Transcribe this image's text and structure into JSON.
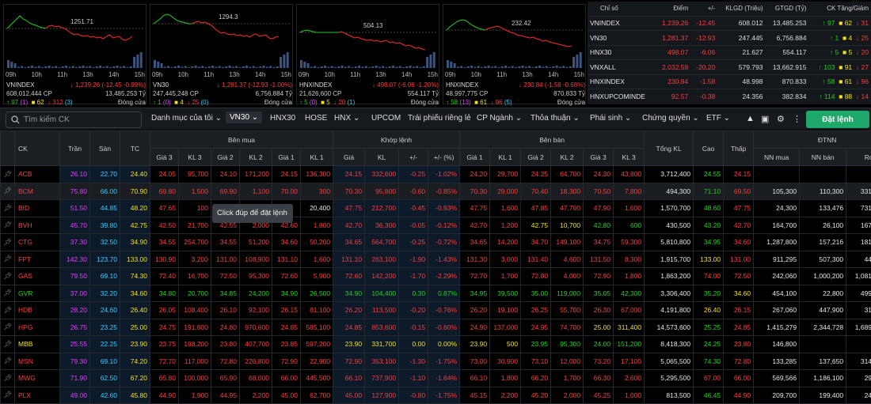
{
  "charts": [
    {
      "name": "VNINDEX",
      "ref_label": "1251.71",
      "value": "1,239.26",
      "change": "(-12.45 -0.99%)",
      "volume": "608,012,444 CP",
      "value_total": "13,485.253 Tỷ",
      "up": "97",
      "up_ceiling": "(1)",
      "ref": "62",
      "down": "312",
      "down_floor": "(3)",
      "status": "Đóng cửa"
    },
    {
      "name": "VN30",
      "ref_label": "1294.3",
      "value": "1,281.37",
      "change": "(-12.93 -1.00%)",
      "volume": "247,445,248 CP",
      "value_total": "6,756.884 Tỷ",
      "up": "1",
      "up_ceiling": "(0)",
      "ref": "4",
      "down": "25",
      "down_floor": "(0)",
      "status": "Đóng cửa"
    },
    {
      "name": "HNXINDEX",
      "ref_label": "504.13",
      "value": "498.07",
      "change": "(-6.06 -1.20%)",
      "volume": "21,626,600 CP",
      "value_total": "554.117 Tỷ",
      "up": "5",
      "up_ceiling": "(0)",
      "ref": "5",
      "down": "20",
      "down_floor": "(1)",
      "status": "Đóng cửa"
    },
    {
      "name": "HNXINDEX",
      "ref_label": "232.42",
      "value": "230.84",
      "change": "(-1.58 -0.68%)",
      "volume": "48,997,775 CP",
      "value_total": "870.833 Tỷ",
      "up": "58",
      "up_ceiling": "(13)",
      "ref": "61",
      "down": "96",
      "down_floor": "(5)",
      "status": "Đóng cửa"
    }
  ],
  "chart_times": [
    "09h",
    "10h",
    "11h",
    "13h",
    "14h",
    "15h"
  ],
  "index_table": {
    "headers": [
      "Chỉ số",
      "Điểm",
      "+/-",
      "KLGD (Triệu)",
      "GTGD (Tỷ)",
      "CK Tăng/Giảm"
    ],
    "rows": [
      {
        "name": "VNINDEX",
        "point": "1,239.26",
        "chg": "-12.45",
        "vol": "608.012",
        "val": "13,485.253",
        "up": "97",
        "ref": "62",
        "down": "31"
      },
      {
        "name": "VN30",
        "point": "1,281.37",
        "chg": "-12.93",
        "vol": "247.445",
        "val": "6,756.884",
        "up": "1",
        "ref": "4",
        "down": "25"
      },
      {
        "name": "HNX30",
        "point": "498.07",
        "chg": "-6.06",
        "vol": "21.627",
        "val": "554.117",
        "up": "5",
        "ref": "5",
        "down": "20"
      },
      {
        "name": "VNXALL",
        "point": "2,032.58",
        "chg": "-20.20",
        "vol": "579.793",
        "val": "13,662.915",
        "up": "103",
        "ref": "91",
        "down": "27"
      },
      {
        "name": "HNXINDEX",
        "point": "230.84",
        "chg": "-1.58",
        "vol": "48.998",
        "val": "870.833",
        "up": "58",
        "ref": "61",
        "down": "96"
      },
      {
        "name": "HNXUPCOMINDE",
        "point": "92.57",
        "chg": "-0.38",
        "vol": "24.356",
        "val": "382.834",
        "up": "114",
        "ref": "88",
        "down": "14"
      }
    ]
  },
  "toolbar": {
    "search_placeholder": "Tìm kiếm CK",
    "tabs": [
      "Danh mục của tôi",
      "VN30",
      "HNX30",
      "HOSE",
      "HNX",
      "UPCOM",
      "Trái phiếu riêng lẻ",
      "CP Ngành",
      "Thỏa thuận",
      "Phái sinh",
      "Chứng quyền",
      "ETF"
    ],
    "order_button": "Đặt lệnh"
  },
  "board": {
    "group_headers": {
      "buy": "Bên mua",
      "match": "Khớp lệnh",
      "sell": "Bên bán",
      "foreign": "ĐTNN"
    },
    "headers": [
      "CK",
      "Trần",
      "Sàn",
      "TC",
      "Giá 3",
      "KL 3",
      "Giá 2",
      "KL 2",
      "Giá 1",
      "KL 1",
      "Giá",
      "KL",
      "+/-",
      "+/- (%)",
      "Giá 1",
      "KL 1",
      "Giá 2",
      "KL 2",
      "Giá 3",
      "KL 3",
      "Tổng KL",
      "Cao",
      "Thấp",
      "NN mua",
      "NN bán",
      "Room"
    ],
    "rows": [
      [
        "ACB",
        "26.10",
        "22.70",
        "24.40",
        "24.05",
        "95,700",
        "24.10",
        "171,200",
        "24.15",
        "136,300",
        "24.15",
        "332,600",
        "-0.25",
        "-1.02%",
        "24.20",
        "29,700",
        "24.25",
        "64,700",
        "24.30",
        "43,800",
        "3,712,400",
        "24.55",
        "24.15",
        "",
        "",
        ""
      ],
      [
        "BCM",
        "75.80",
        "66.00",
        "70.90",
        "69.80",
        "1,500",
        "69.90",
        "1,100",
        "70.00",
        "300",
        "70.30",
        "95,800",
        "-0.60",
        "-0.85%",
        "70.30",
        "29,000",
        "70.40",
        "18,300",
        "70.50",
        "7,800",
        "494,300",
        "71.10",
        "69.50",
        "105,300",
        "110,300",
        "331,191,861"
      ],
      [
        "BID",
        "51.50",
        "44.85",
        "48.20",
        "47.65",
        "100",
        "",
        "",
        "",
        "20,400",
        "47.75",
        "212,700",
        "-0.45",
        "-0.93%",
        "47.75",
        "1,600",
        "47.85",
        "47,700",
        "47.90",
        "1,600",
        "1,570,700",
        "48.60",
        "47.75",
        "24,300",
        "133,476",
        "731,050,568"
      ],
      [
        "BVH",
        "45.70",
        "39.80",
        "42.75",
        "42.50",
        "21,700",
        "42.55",
        "2,000",
        "42.60",
        "1,800",
        "42.70",
        "36,300",
        "-0.05",
        "-0.12%",
        "42.70",
        "1,200",
        "42.75",
        "10,700",
        "42.80",
        "600",
        "430,500",
        "43.20",
        "42.70",
        "164,700",
        "26,100",
        "167,077,494"
      ],
      [
        "CTG",
        "37.30",
        "32.50",
        "34.90",
        "34.55",
        "254,700",
        "34.55",
        "51,200",
        "34.60",
        "50,200",
        "34.65",
        "564,700",
        "-0.25",
        "-0.72%",
        "34.65",
        "14,200",
        "34.70",
        "149,100",
        "34.75",
        "59,300",
        "5,810,800",
        "34.95",
        "34.60",
        "1,287,800",
        "157,216",
        "181,424,747"
      ],
      [
        "FPT",
        "142.30",
        "123.70",
        "133.00",
        "130.90",
        "3,200",
        "131.00",
        "108,900",
        "131.10",
        "1,600",
        "131.10",
        "263,100",
        "-1.90",
        "-1.43%",
        "131.30",
        "3,000",
        "131.40",
        "4,600",
        "131.50",
        "8,300",
        "1,915,700",
        "133.00",
        "131.00",
        "911,295",
        "507,300",
        "44,837,442"
      ],
      [
        "GAS",
        "79.50",
        "69.10",
        "74.30",
        "72.40",
        "16,700",
        "72.50",
        "95,300",
        "72.60",
        "5,900",
        "72.60",
        "142,200",
        "-1.70",
        "-2.29%",
        "72.70",
        "1,700",
        "72.80",
        "4,000",
        "72.90",
        "1,800",
        "1,863,200",
        "74.00",
        "72.50",
        "242,060",
        "1,000,200",
        "1,081,847,322"
      ],
      [
        "GVR",
        "37.00",
        "32.20",
        "34.60",
        "34.80",
        "20,700",
        "34.85",
        "24,200",
        "34.90",
        "26,500",
        "34.90",
        "104,400",
        "0.30",
        "0.87%",
        "34.95",
        "39,500",
        "35.00",
        "119,000",
        "35.05",
        "42,300",
        "3,306,400",
        "35.20",
        "34.60",
        "454,100",
        "22,800",
        "499,081,531"
      ],
      [
        "HDB",
        "28.20",
        "24.60",
        "26.40",
        "26.05",
        "108,400",
        "26.10",
        "92,100",
        "26.15",
        "81,100",
        "26.20",
        "113,500",
        "-0.20",
        "-0.76%",
        "26.20",
        "19,100",
        "26.25",
        "55,700",
        "26.30",
        "67,000",
        "4,191,800",
        "26.40",
        "26.15",
        "267,060",
        "447,900",
        "31,462,632"
      ],
      [
        "HPG",
        "26.75",
        "23.25",
        "25.00",
        "24.75",
        "191,600",
        "24.80",
        "970,600",
        "24.85",
        "585,100",
        "24.85",
        "853,600",
        "-0.15",
        "-0.60%",
        "24.90",
        "137,000",
        "24.95",
        "74,700",
        "25.00",
        "311,400",
        "14,573,600",
        "25.25",
        "24.85",
        "1,415,279",
        "2,344,728",
        "1,689,677,853"
      ],
      [
        "MBB",
        "25.55",
        "22.25",
        "23.90",
        "23.75",
        "198,200",
        "23.80",
        "407,700",
        "23.85",
        "597,200",
        "23.90",
        "331,700",
        "0.00",
        "0.00%",
        "23.90",
        "500",
        "23.95",
        "95,300",
        "24.00",
        "151,200",
        "8,418,300",
        "24.25",
        "23.80",
        "146,800",
        "",
        ""
      ],
      [
        "MSN",
        "79.30",
        "69.10",
        "74.20",
        "72.70",
        "117,000",
        "72.80",
        "226,800",
        "72.90",
        "22,900",
        "72.90",
        "353,100",
        "-1.30",
        "-1.75%",
        "73.00",
        "30,900",
        "73.10",
        "12,000",
        "73.20",
        "17,100",
        "5,065,500",
        "74.30",
        "72.80",
        "133,285",
        "137,650",
        "314,746,242"
      ],
      [
        "MWG",
        "71.90",
        "62.50",
        "67.20",
        "65.80",
        "100,000",
        "65.90",
        "68,000",
        "66.00",
        "445,500",
        "66.10",
        "737,900",
        "-1.10",
        "-1.64%",
        "66.10",
        "1,800",
        "66.20",
        "1,700",
        "66.30",
        "2,600",
        "5,295,500",
        "67.00",
        "66.00",
        "569,566",
        "1,186,100",
        "29,749,060"
      ],
      [
        "PLX",
        "49.00",
        "42.60",
        "45.80",
        "44.90",
        "1,900",
        "44.95",
        "2,200",
        "45.00",
        "62,700",
        "45.00",
        "127,900",
        "-0.80",
        "-1.75%",
        "45.15",
        "2,200",
        "45.20",
        "2,000",
        "45.25",
        "1,000",
        "813,500",
        "46.45",
        "44.90",
        "209,700",
        "199,400",
        "24,277,720"
      ]
    ]
  },
  "tooltip": "Click đúp để đặt lệnh",
  "colors": {
    "up": "#1fd11f",
    "down": "#ff3b3b",
    "ref": "#f0e020",
    "ceiling": "#e040fb",
    "floor": "#33ccff",
    "accent": "#1ea86a"
  }
}
